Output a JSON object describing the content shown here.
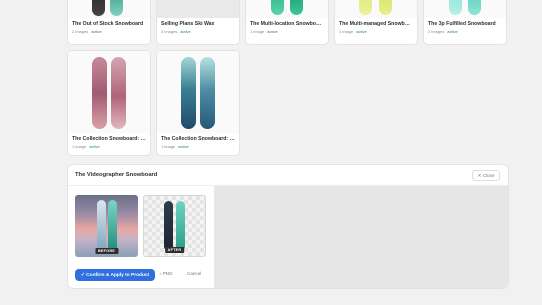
{
  "products": [
    {
      "title": "The Out of Stock Snowboard",
      "images": "2 images",
      "status": "active"
    },
    {
      "title": "Selling Plans Ski Wax",
      "images": "3 images",
      "status": "active"
    },
    {
      "title": "The Multi-location Snowboard",
      "images": "1 image",
      "status": "active"
    },
    {
      "title": "The Multi-managed Snowboard",
      "images": "1 image",
      "status": "active"
    },
    {
      "title": "The 3p Fulfilled Snowboard",
      "images": "2 images",
      "status": "active"
    },
    {
      "title": "The Collection Snowboard: Ox...",
      "images": "1 image",
      "status": "active"
    },
    {
      "title": "The Collection Snowboard: Liq...",
      "images": "1 image",
      "status": "active"
    }
  ],
  "editor": {
    "title": "The Videographer Snowboard",
    "close_label": "✕ Close",
    "before_label": "BEFORE",
    "after_label": "AFTER",
    "confirm_label": "✓ Confirm & Apply to Product",
    "png_label": "↓ PNG",
    "cancel_label": "Cancel"
  },
  "colors": {
    "accent": "#2f6fde",
    "status_active": "#1f8a65"
  }
}
